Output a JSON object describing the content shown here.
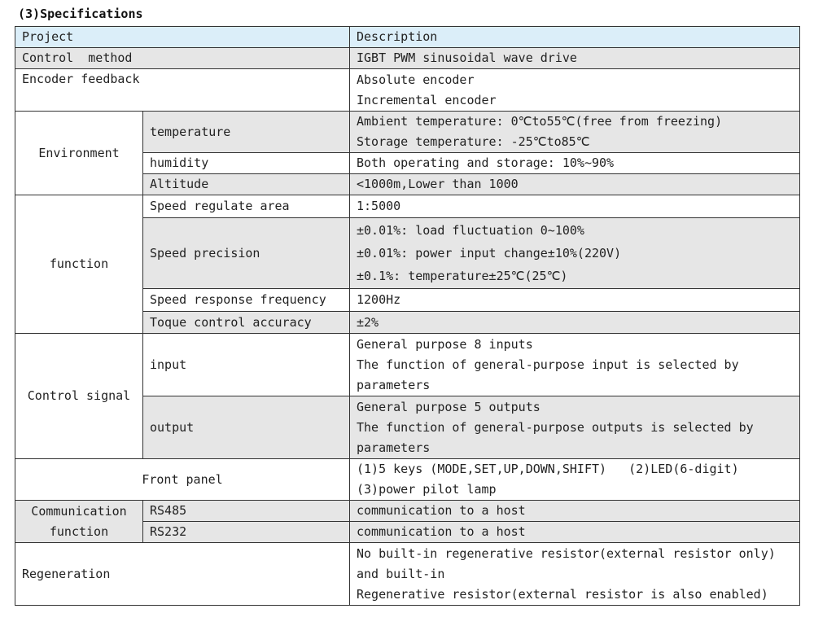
{
  "heading": "(3)Specifications",
  "header": {
    "project": "Project",
    "description": "Description"
  },
  "control_method": {
    "label": "Control  method",
    "value": "IGBT PWM sinusoidal wave drive"
  },
  "encoder_feedback": {
    "label": "Encoder feedback",
    "lines": [
      "Absolute encoder",
      "Incremental encoder"
    ]
  },
  "environment": {
    "label": "Environment",
    "temperature": {
      "label": "temperature",
      "lines": [
        "Ambient temperature:  0℃to55℃(free from freezing)",
        "Storage temperature:  -25℃to85℃"
      ]
    },
    "humidity": {
      "label": "humidity",
      "value": "Both operating and storage: 10%~90%"
    },
    "altitude": {
      "label": "Altitude",
      "value": "<1000m,Lower than 1000"
    }
  },
  "function": {
    "label": "function",
    "speed_regulate_area": {
      "label": "Speed regulate area",
      "value": "1:5000"
    },
    "speed_precision": {
      "label": "Speed precision",
      "lines": [
        "±0.01%: load fluctuation 0~100%",
        "±0.01%: power input change±10%(220V)",
        "±0.1%: temperature±25℃(25℃)"
      ]
    },
    "speed_response": {
      "label": "Speed response frequency",
      "value": "1200Hz"
    },
    "toque_control": {
      "label": "Toque control accuracy",
      "value": "±2%"
    }
  },
  "control_signal": {
    "label": "Control signal",
    "input": {
      "label": "input",
      "lines": [
        "General purpose 8 inputs",
        "The function of general-purpose input is selected by",
        "parameters"
      ]
    },
    "output": {
      "label": "output",
      "lines": [
        "General purpose 5 outputs",
        "The function of general-purpose outputs is selected by",
        "parameters"
      ]
    }
  },
  "front_panel": {
    "label": "Front panel",
    "lines": [
      "(1)5 keys (MODE,SET,UP,DOWN,SHIFT)   (2)LED(6-digit)",
      "(3)power pilot lamp"
    ]
  },
  "communication": {
    "label_lines": [
      "Communication",
      "function"
    ],
    "rs485": {
      "label": "RS485",
      "value": "communication to a host"
    },
    "rs232": {
      "label": "RS232",
      "value": "communication to a host"
    }
  },
  "regeneration": {
    "label": "Regeneration",
    "lines": [
      "No built-in regenerative resistor(external resistor only)",
      "and built-in",
      "Regenerative resistor(external resistor is also enabled)"
    ]
  }
}
